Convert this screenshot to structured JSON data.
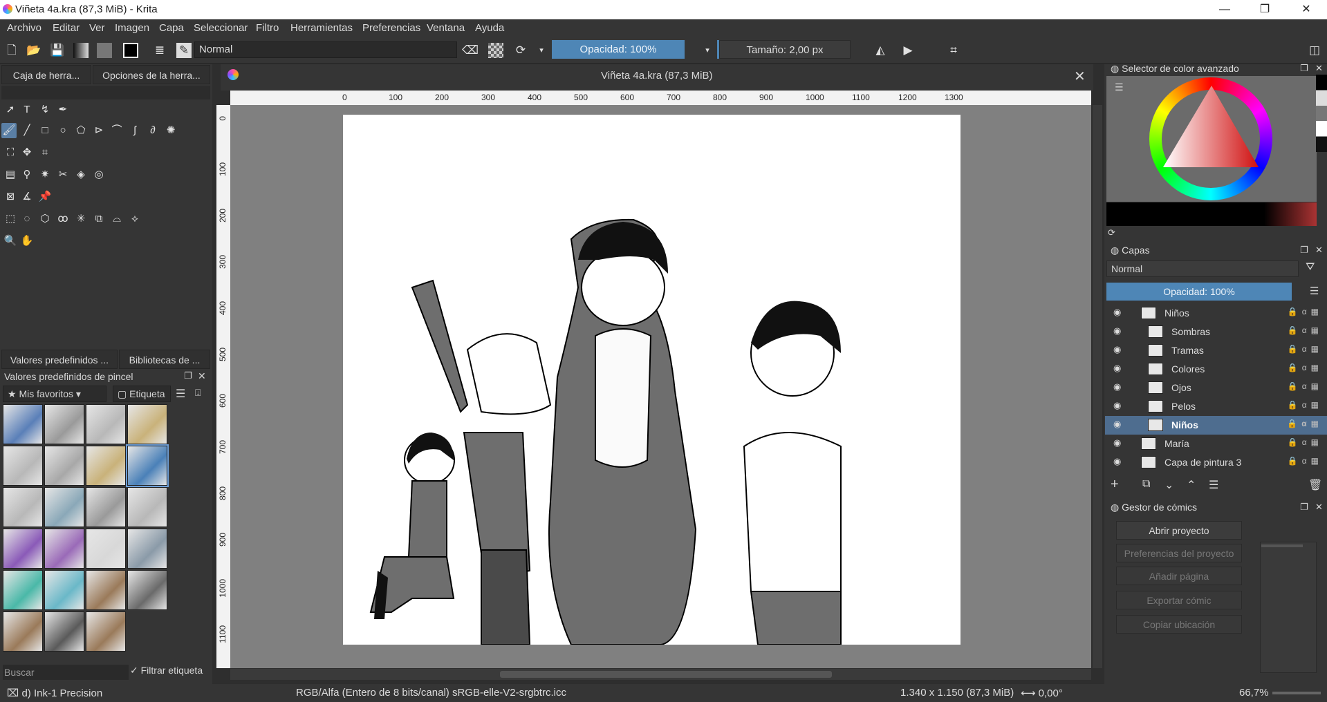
{
  "title": "Viñeta 4a.kra (87,3 MiB)  - Krita",
  "menu": [
    "Archivo",
    "Editar",
    "Ver",
    "Imagen",
    "Capa",
    "Seleccionar",
    "Filtro",
    "Herramientas",
    "Preferencias",
    "Ventana",
    "Ayuda"
  ],
  "toolbar": {
    "blend_mode": "Normal",
    "opacity": "Opacidad: 100%",
    "size": "Tamaño: 2,00 px"
  },
  "left_panel": {
    "tabs": [
      "Caja de herra...",
      "Opciones de la herra..."
    ],
    "bottom_tabs": [
      "Valores predefinidos ...",
      "Bibliotecas de ..."
    ],
    "presets_title": "Valores predefinidos de pincel",
    "favorites": "Mis favoritos",
    "tag": "Etiqueta",
    "search_placeholder": "Buscar",
    "filter_tag": "Filtrar etiqueta"
  },
  "document": {
    "tab_title": "Viñeta 4a.kra (87,3 MiB)",
    "ruler_h": [
      "0",
      "100",
      "200",
      "300",
      "400",
      "500",
      "600",
      "700",
      "800",
      "900",
      "1000",
      "1100",
      "1200",
      "1300"
    ],
    "ruler_v": [
      "0",
      "100",
      "200",
      "300",
      "400",
      "500",
      "600",
      "700",
      "800",
      "900",
      "1000",
      "1100"
    ]
  },
  "color_selector": {
    "title": "Selector de color avanzado"
  },
  "layers": {
    "title": "Capas",
    "blend": "Normal",
    "opacity": "Opacidad:  100%",
    "items": [
      {
        "name": "Niños"
      },
      {
        "name": "Sombras"
      },
      {
        "name": "Tramas"
      },
      {
        "name": "Colores"
      },
      {
        "name": "Ojos"
      },
      {
        "name": "Pelos"
      },
      {
        "name": "Niños"
      },
      {
        "name": "María"
      },
      {
        "name": "Capa de pintura 3"
      }
    ]
  },
  "comic_manager": {
    "title": "Gestor de cómics",
    "buttons": [
      "Abrir proyecto",
      "Preferencias del proyecto",
      "Añadir página",
      "Exportar cómic",
      "Copiar ubicación"
    ]
  },
  "status": {
    "brush": "d) Ink-1 Precision",
    "color_space": "RGB/Alfa (Entero de 8 bits/canal)  sRGB-elle-V2-srgbtrc.icc",
    "dimensions": "1.340 x 1.150 (87,3 MiB)",
    "rotation": "0,00°",
    "zoom": "66,7%"
  }
}
